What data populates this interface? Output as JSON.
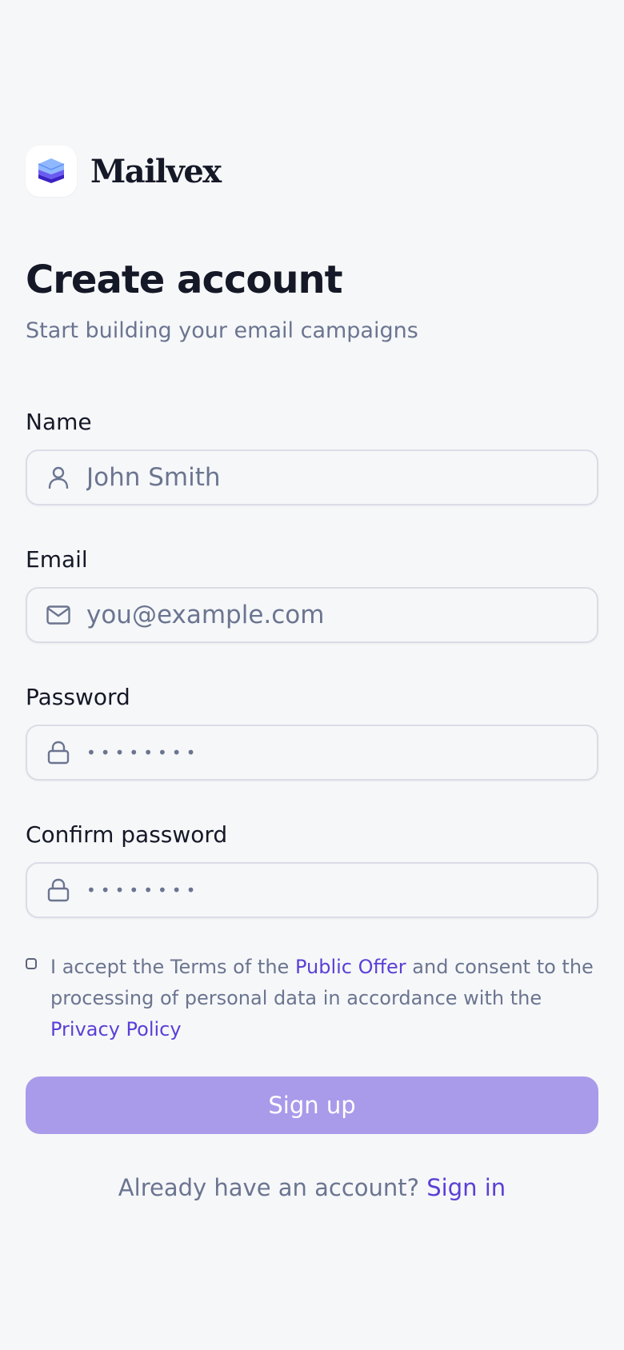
{
  "brand": {
    "name": "Mailvex",
    "logo_icon": "stacked-envelopes-icon"
  },
  "header": {
    "title": "Create account",
    "subtitle": "Start building your email campaigns"
  },
  "form": {
    "name": {
      "label": "Name",
      "placeholder": "John Smith",
      "icon": "user-icon"
    },
    "email": {
      "label": "Email",
      "placeholder": "you@example.com",
      "icon": "mail-icon"
    },
    "password": {
      "label": "Password",
      "value_masked": "••••••••",
      "icon": "lock-icon"
    },
    "confirm_password": {
      "label": "Confirm password",
      "value_masked": "••••••••",
      "icon": "lock-icon"
    },
    "consent": {
      "checked": false,
      "text_1": "I accept the Terms of the ",
      "link_offer": "Public Offer",
      "text_2": " and consent to the processing of personal data in accordance with the ",
      "link_privacy": "Privacy Policy"
    },
    "submit_label": "Sign up"
  },
  "footer": {
    "prompt": "Already have an account?",
    "link": "Sign in"
  },
  "colors": {
    "background": "#f6f7f9",
    "accent": "#5b3fd6",
    "button_disabled": "#a99bea",
    "muted_text": "#6b7590",
    "primary_text": "#151826"
  }
}
